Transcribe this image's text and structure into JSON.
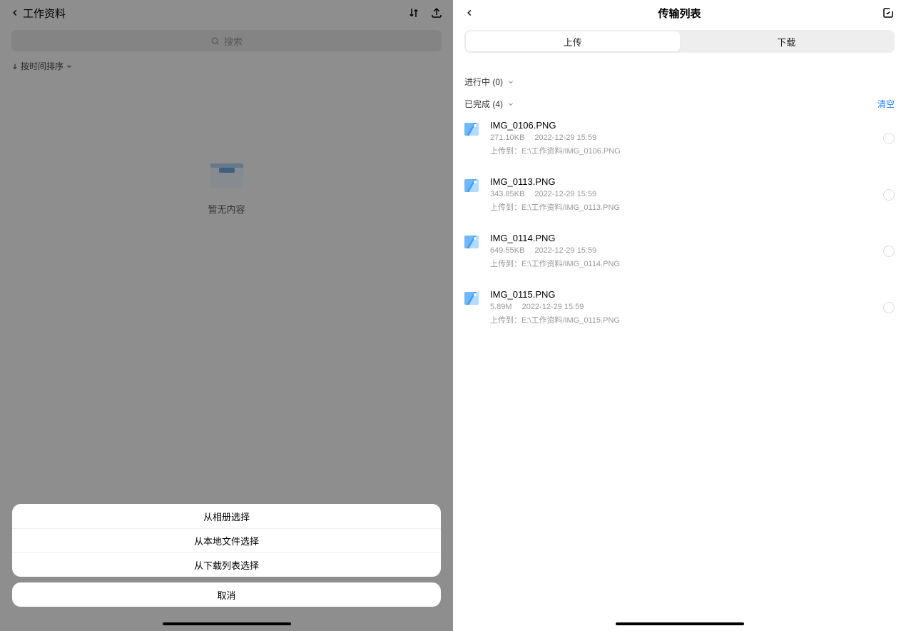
{
  "left": {
    "title": "工作资料",
    "search_placeholder": "搜索",
    "sort_label": "按时间排序",
    "empty_text": "暂无内容",
    "sheet": {
      "album": "从相册选择",
      "local": "从本地文件选择",
      "download": "从下载列表选择",
      "cancel": "取消"
    }
  },
  "right": {
    "title": "传输列表",
    "tabs": {
      "upload": "上传",
      "download": "下载"
    },
    "inprogress_label": "进行中 (0)",
    "completed_label": "已完成 (4)",
    "clear_label": "清空",
    "files": [
      {
        "name": "IMG_0106.PNG",
        "size": "271.10KB",
        "time": "2022-12-29 15:59",
        "path": "上传到：E:\\工作资料/IMG_0106.PNG"
      },
      {
        "name": "IMG_0113.PNG",
        "size": "343.85KB",
        "time": "2022-12-29 15:59",
        "path": "上传到：E:\\工作资料/IMG_0113.PNG"
      },
      {
        "name": "IMG_0114.PNG",
        "size": "649.55KB",
        "time": "2022-12-29 15:59",
        "path": "上传到：E:\\工作资料/IMG_0114.PNG"
      },
      {
        "name": "IMG_0115.PNG",
        "size": "5.89M",
        "time": "2022-12-29 15:59",
        "path": "上传到：E:\\工作资料/IMG_0115.PNG"
      }
    ]
  }
}
